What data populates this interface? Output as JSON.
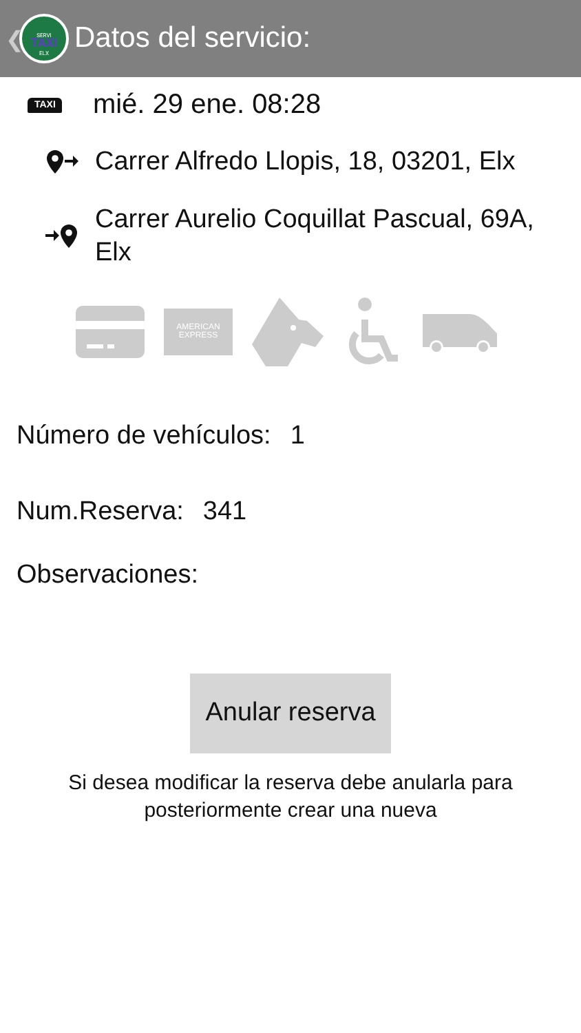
{
  "header": {
    "back": "❮",
    "logo": {
      "top": "SERVI",
      "middle": "TAXI",
      "bottom": "ELX"
    },
    "title": "Datos del servicio:"
  },
  "date": {
    "badge": "TAXI",
    "text": "mié. 29 ene. 08:28"
  },
  "origin": "Carrer Alfredo Llopis, 18, 03201, Elx",
  "destination": "Carrer Aurelio Coquillat Pascual, 69A, Elx",
  "services": [
    {
      "kind": "card",
      "on": false
    },
    {
      "kind": "amex",
      "on": false,
      "label": "AMERICAN EXPRESS"
    },
    {
      "kind": "dog",
      "on": false
    },
    {
      "kind": "wheelchair",
      "on": false
    },
    {
      "kind": "van",
      "on": false
    }
  ],
  "fields": [
    {
      "label": "Número de vehículos:",
      "value": "1"
    },
    {
      "label": "Num.Reserva:",
      "value": "341"
    },
    {
      "label": "Observaciones:"
    }
  ],
  "button": "Anular reserva",
  "note": "Si desea modificar la reserva debe anularla para posteriormente crear una nueva"
}
